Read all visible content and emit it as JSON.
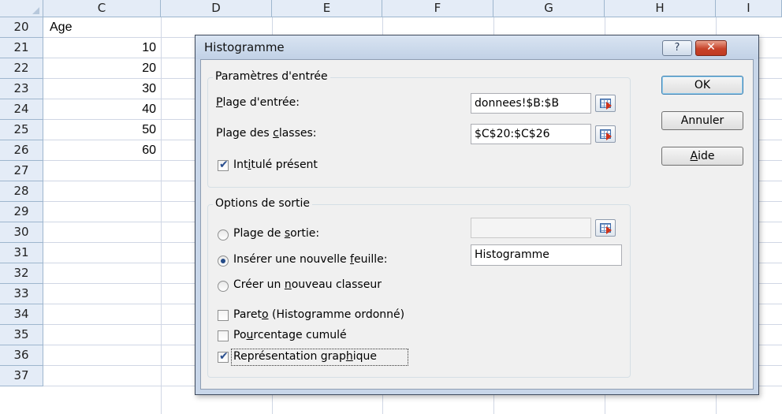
{
  "spreadsheet": {
    "columns": [
      "C",
      "D",
      "E",
      "F",
      "G",
      "H",
      "I"
    ],
    "rows": [
      "20",
      "21",
      "22",
      "23",
      "24",
      "25",
      "26",
      "27",
      "28",
      "29",
      "30",
      "31",
      "32",
      "33",
      "34",
      "35",
      "36",
      "37"
    ],
    "column_c_header": "Age",
    "column_c_values": [
      "10",
      "20",
      "30",
      "40",
      "50",
      "60"
    ]
  },
  "dialog": {
    "title": "Histogramme",
    "help_label": "?",
    "close_label": "✕",
    "input_group": {
      "legend": "Paramètres d'entrée",
      "input_range_label_1": "P",
      "input_range_label_2": "lage d'entrée:",
      "input_range_value": "donnees!$B:$B",
      "bin_range_label_1": "Plage des ",
      "bin_range_label_2": "c",
      "bin_range_label_3": "lasses:",
      "bin_range_value": "$C$20:$C$26",
      "labels_label_1": "Int",
      "labels_label_2": "i",
      "labels_label_3": "tulé présent",
      "labels_checked": true
    },
    "output_group": {
      "legend": "Options de sortie",
      "output_range_label_1": "Plage de ",
      "output_range_label_2": "s",
      "output_range_label_3": "ortie:",
      "output_range_value": "",
      "new_sheet_label_1": "Insérer une nouvelle ",
      "new_sheet_label_2": "f",
      "new_sheet_label_3": "euille:",
      "new_sheet_value": "Histogramme",
      "new_workbook_label_1": "Créer un ",
      "new_workbook_label_2": "n",
      "new_workbook_label_3": "ouveau classeur",
      "selected_option": "new_sheet",
      "pareto_label_1": "Paret",
      "pareto_label_2": "o",
      "pareto_label_3": " (Histogramme ordonné)",
      "pareto_checked": false,
      "cumulative_label_1": "Po",
      "cumulative_label_2": "u",
      "cumulative_label_3": "rcentage cumulé",
      "cumulative_checked": false,
      "chart_label_1": "Représentation grap",
      "chart_label_2": "h",
      "chart_label_3": "ique",
      "chart_checked": true
    },
    "buttons": {
      "ok": "OK",
      "cancel": "Annuler",
      "help_1": "A",
      "help_2": "ide"
    }
  },
  "colors": {
    "header_bg": "#e4ecf7",
    "grid_line": "#d0d7e5",
    "dialog_frame": "#c8d6e9",
    "close_button": "#c7432a"
  }
}
